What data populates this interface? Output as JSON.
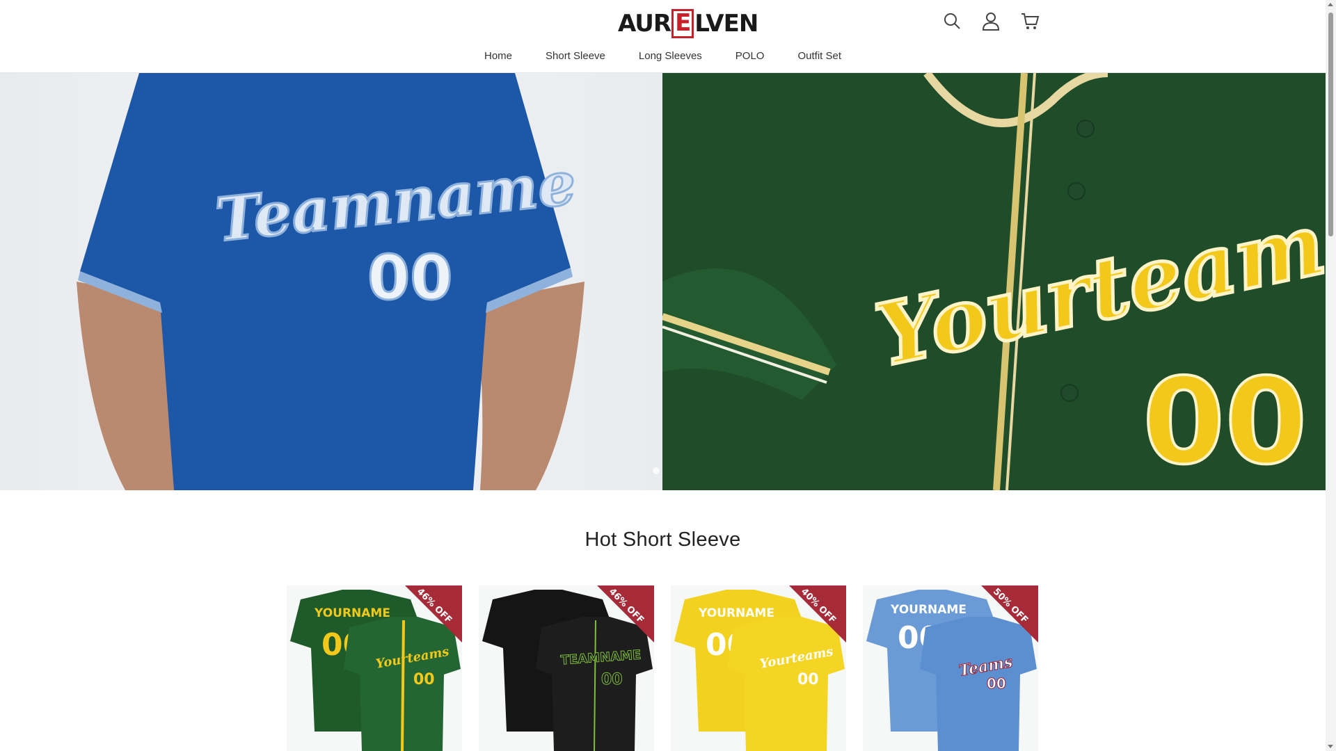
{
  "brand": {
    "name_left": "AUR",
    "name_mark": "E",
    "name_right": "LVEN"
  },
  "header_icons": [
    "search-icon",
    "account-icon",
    "cart-icon"
  ],
  "nav": {
    "items": [
      "Home",
      "Short Sleeve",
      "Long Sleeves",
      "POLO",
      "Outfit Set"
    ]
  },
  "hero": {
    "left_jersey_text": "Teamname",
    "left_jersey_number": "00",
    "right_jersey_text": "Yourteams",
    "right_jersey_number": "00"
  },
  "section": {
    "title": "Hot Short Sleeve"
  },
  "products": [
    {
      "badge": "46% OFF",
      "jersey_back": "YOURNAME",
      "jersey_front": "Yourteams",
      "number": "00",
      "colors": {
        "body": "#1f5a2a",
        "accent": "#f2c91b",
        "trim": "#ffffff"
      }
    },
    {
      "badge": "46% OFF",
      "jersey_back": "",
      "jersey_front": "TEAMNAME",
      "number": "00",
      "colors": {
        "body": "#121212",
        "accent": "#7fbf3b",
        "trim": "#7fbf3b"
      }
    },
    {
      "badge": "40% OFF",
      "jersey_back": "YOURNAME",
      "jersey_front": "Yourteams",
      "number": "00",
      "colors": {
        "body": "#f2d21f",
        "accent": "#ffffff",
        "trim": "#ffffff"
      }
    },
    {
      "badge": "50% OFF",
      "jersey_back": "YOURNAME",
      "jersey_front": "Teams",
      "number": "00",
      "colors": {
        "body": "#6a9bd6",
        "accent": "#ffffff",
        "trim": "#9b2236"
      }
    }
  ],
  "colors": {
    "badge": "#a62a38",
    "brand_red": "#c8202a"
  }
}
